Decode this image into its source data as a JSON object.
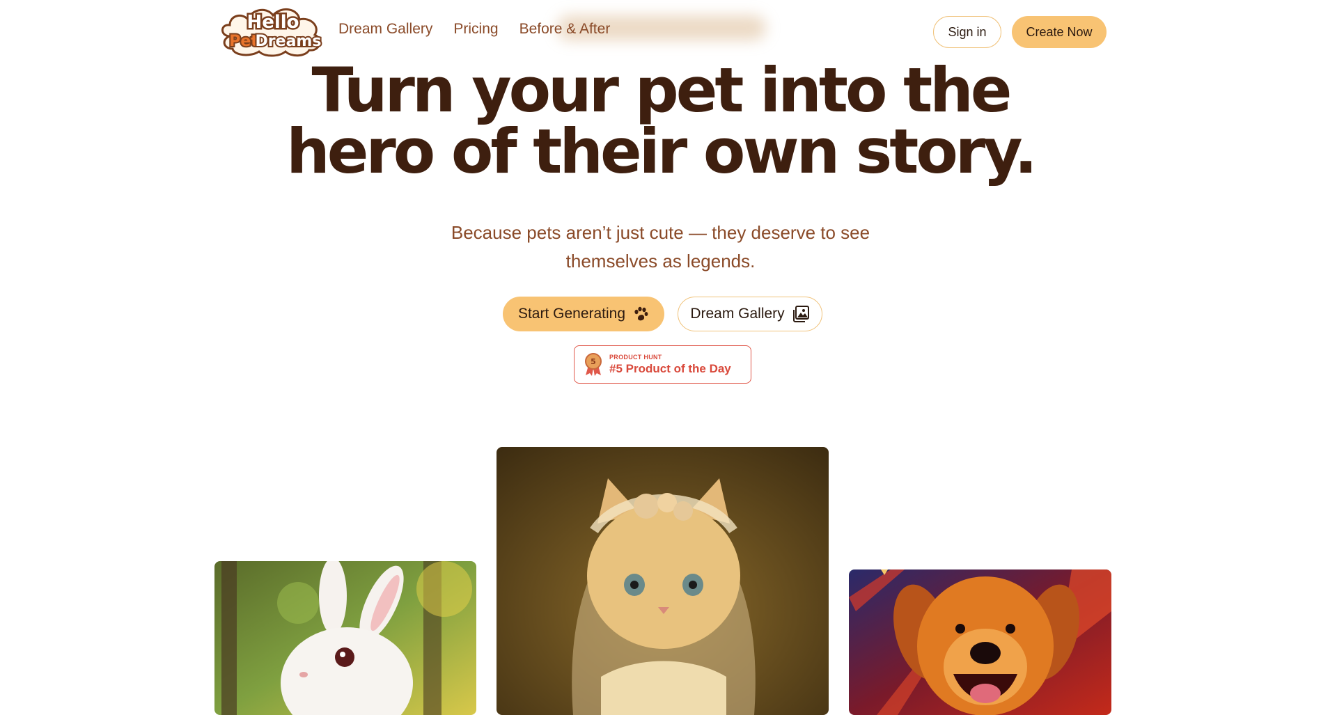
{
  "brand": {
    "logo_line1": "Hello",
    "logo_pet": "Pet",
    "logo_dreams": "Dreams",
    "colors": {
      "brown": "#3e1f0f",
      "accent": "#f8c373",
      "orange": "#e8742c",
      "ph_red": "#d9493b"
    }
  },
  "nav": {
    "items": [
      {
        "label": "Dream Gallery"
      },
      {
        "label": "Pricing"
      },
      {
        "label": "Before & After"
      }
    ],
    "sign_in": "Sign in",
    "create_now": "Create Now"
  },
  "hero": {
    "title_line1": "Turn your pet into the",
    "title_line2": "hero of their own story.",
    "subtitle_line1": "Because pets aren’t just cute — they deserve to see",
    "subtitle_line2": "themselves as legends.",
    "primary_cta": {
      "label": "Start Generating",
      "icon": "paw-icon"
    },
    "secondary_cta": {
      "label": "Dream Gallery",
      "icon": "gallery-icon"
    }
  },
  "product_hunt": {
    "kicker": "PRODUCT HUNT",
    "title": "#5 Product of the Day",
    "medal_number": "5",
    "icon": "medal-icon"
  },
  "gallery": [
    {
      "subject": "white rabbit in forest",
      "icon": "rabbit-image"
    },
    {
      "subject": "cat in bridal veil portrait",
      "icon": "cat-image"
    },
    {
      "subject": "golden retriever painting",
      "icon": "dog-image"
    }
  ]
}
